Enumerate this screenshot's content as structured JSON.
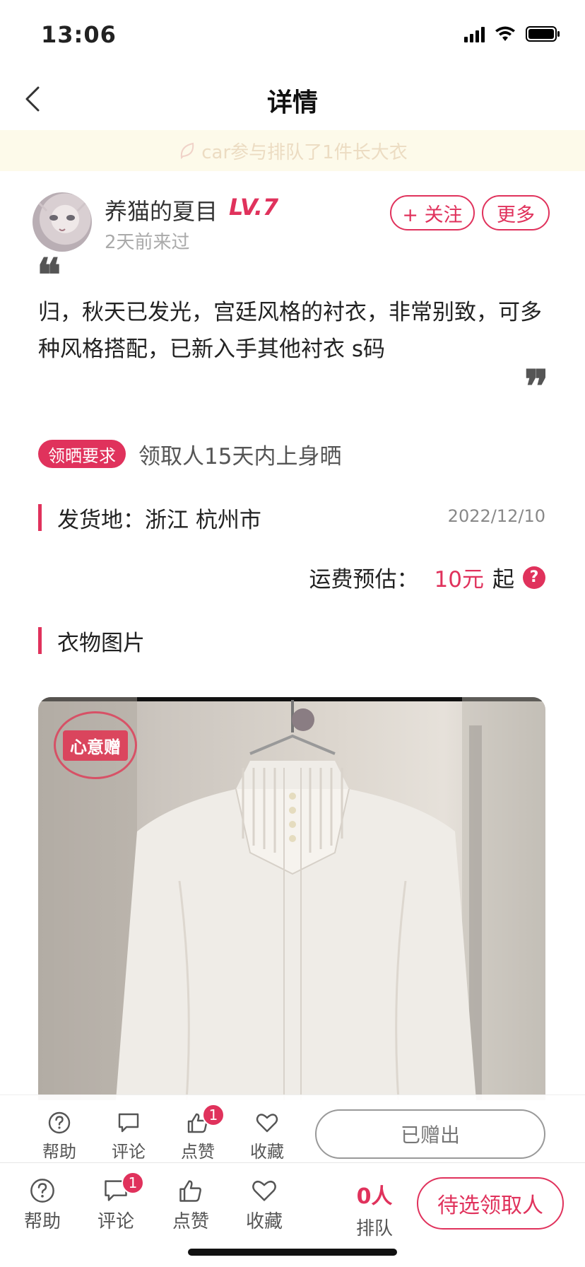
{
  "status_bar": {
    "time": "13:06"
  },
  "nav": {
    "title": "详情"
  },
  "banner": {
    "text": "car参与排队了1件长大衣"
  },
  "user": {
    "name": "养猫的夏目",
    "level": "LV.7",
    "last_seen": "2天前来过",
    "follow_label": "+ 关注",
    "more_label": "更多"
  },
  "description": {
    "open_quote": "❝",
    "text": "归，秋天已发光，宫廷风格的衬衣，非常别致，可多种风格搭配，已新入手其他衬衣 s码",
    "close_quote": "❞"
  },
  "requirement": {
    "badge": "领晒要求",
    "text": "领取人15天内上身晒"
  },
  "shipping": {
    "origin_label": "发货地：浙江 杭州市",
    "date": "2022/12/10",
    "fee_label": "运费预估：",
    "fee_value": "10元",
    "fee_suffix": "起",
    "help_glyph": "?"
  },
  "photos": {
    "section_title": "衣物图片",
    "stamp_text": "心意赠"
  },
  "overlay_bar": {
    "help": "帮助",
    "comment": "评论",
    "like": "点赞",
    "like_badge": "1",
    "favorite": "收藏",
    "given_label": "已赠出"
  },
  "bottom_bar": {
    "help": "帮助",
    "comment": "评论",
    "comment_badge": "1",
    "like": "点赞",
    "favorite": "收藏",
    "queue_count": "0人",
    "queue_label": "排队",
    "pick_label": "待选领取人"
  },
  "colors": {
    "accent": "#e0325c",
    "banner_bg": "#fdfaea"
  }
}
